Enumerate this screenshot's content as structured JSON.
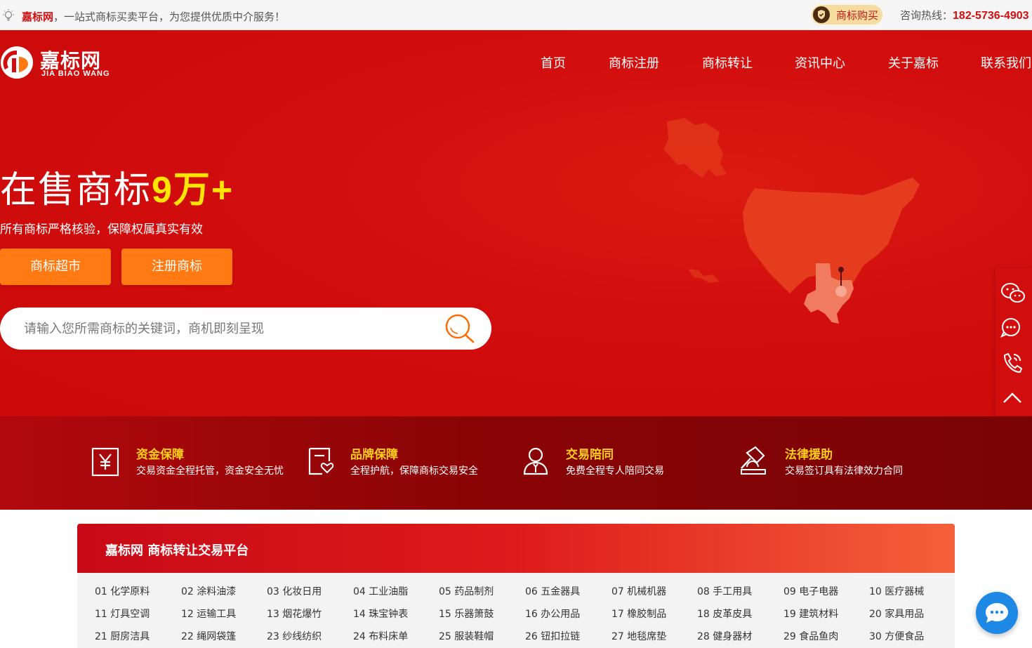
{
  "topbar": {
    "brand": "嘉标网",
    "slogan": "，一站式商标买卖平台，为您提供优质中介服务！",
    "buy_label": "商标购买",
    "hotline_label": "咨询热线：",
    "hotline_number": "182-5736-4903"
  },
  "header": {
    "logo_text": "嘉标网",
    "logo_pinyin": "JIA BIAO WANG",
    "nav": [
      "首页",
      "商标注册",
      "商标转让",
      "资讯中心",
      "关于嘉标",
      "联系我们"
    ]
  },
  "hero": {
    "title_prefix": "在售商标",
    "title_number": "9万+",
    "subtitle": "所有商标严格核验，保障权属真实有效",
    "btn_market": "商标超市",
    "btn_register": "注册商标",
    "search_placeholder": "请输入您所需商标的关键词，商机即刻呈现"
  },
  "features": [
    {
      "icon": "yen-icon",
      "title": "资金保障",
      "desc": "交易资金全程托管，资金安全无忧"
    },
    {
      "icon": "heart-document-icon",
      "title": "品牌保障",
      "desc": "全程护航，保障商标交易安全"
    },
    {
      "icon": "person-icon",
      "title": "交易陪同",
      "desc": "免费全程专人陪同交易"
    },
    {
      "icon": "gavel-icon",
      "title": "法律援助",
      "desc": "交易签订具有法律效力合同"
    }
  ],
  "panel": {
    "title": "嘉标网 商标转让交易平台",
    "categories": [
      "01 化学原料",
      "02 涂料油漆",
      "03 化妆日用",
      "04 工业油脂",
      "05 药品制剂",
      "06 五金器具",
      "07 机械机器",
      "08 手工用具",
      "09 电子电器",
      "10 医疗器械",
      "11 灯具空调",
      "12 运输工具",
      "13 烟花爆竹",
      "14 珠宝钟表",
      "15 乐器箫鼓",
      "16 办公用品",
      "17 橡胶制品",
      "18 皮革皮具",
      "19 建筑材料",
      "20 家具用品",
      "21 厨房洁具",
      "22 绳网袋篷",
      "23 纱线纺织",
      "24 布料床单",
      "25 服装鞋帽",
      "26 钮扣拉链",
      "27 地毯席垫",
      "28 健身器材",
      "29 食品鱼肉",
      "30 方便食品"
    ]
  },
  "sidebar": [
    "wechat-icon",
    "message-icon",
    "phone-icon",
    "back-to-top-icon"
  ],
  "colors": {
    "brand_red": "#d10d0d",
    "accent_orange": "#ff7a12",
    "highlight_yellow": "#ffe500",
    "dark_red": "#7a0306"
  }
}
